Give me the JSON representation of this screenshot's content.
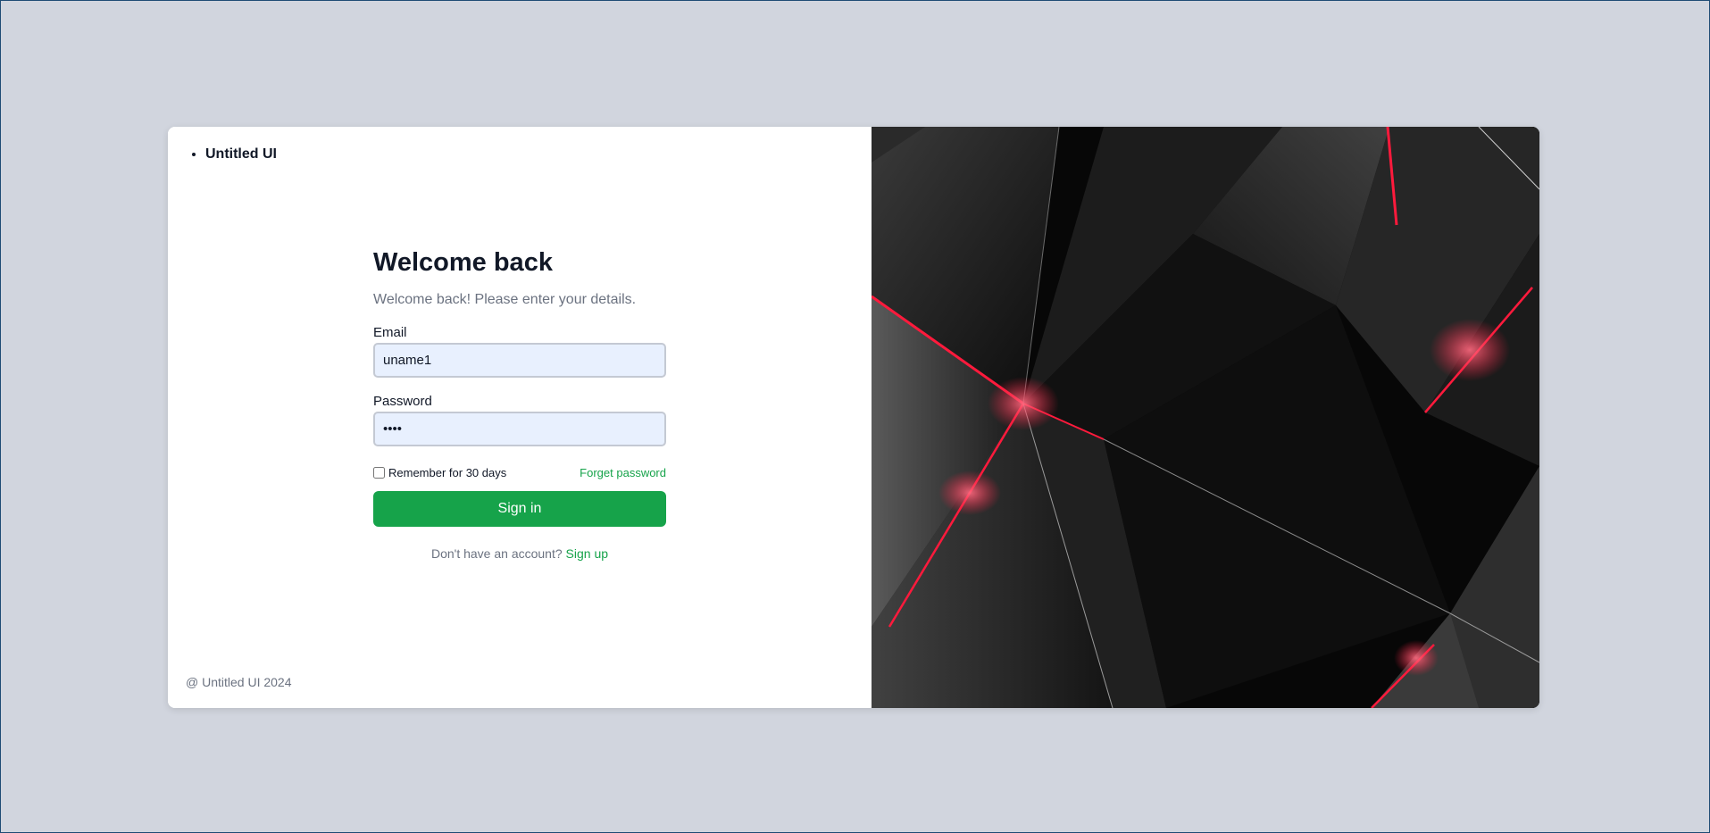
{
  "brand": {
    "name": "Untitled UI"
  },
  "form": {
    "title": "Welcome back",
    "subtitle": "Welcome back! Please enter your details.",
    "email_label": "Email",
    "email_value": "uname1",
    "password_label": "Password",
    "password_value": "••••",
    "remember_label": "Remember for 30 days",
    "forgot_label": "Forget password",
    "signin_label": "Sign in",
    "no_account_text": "Don't have an account?",
    "signup_label": "Sign up"
  },
  "footer": {
    "copyright": "@ Untitled UI 2024"
  },
  "colors": {
    "page_background": "#d1d5de",
    "accent_green": "#16a34a",
    "input_background": "#e8f0fe",
    "hero_background": "#0a0a0a",
    "hero_highlight": "#ff1a3c"
  },
  "hero": {
    "icon": "abstract-dark-polygons-image"
  }
}
